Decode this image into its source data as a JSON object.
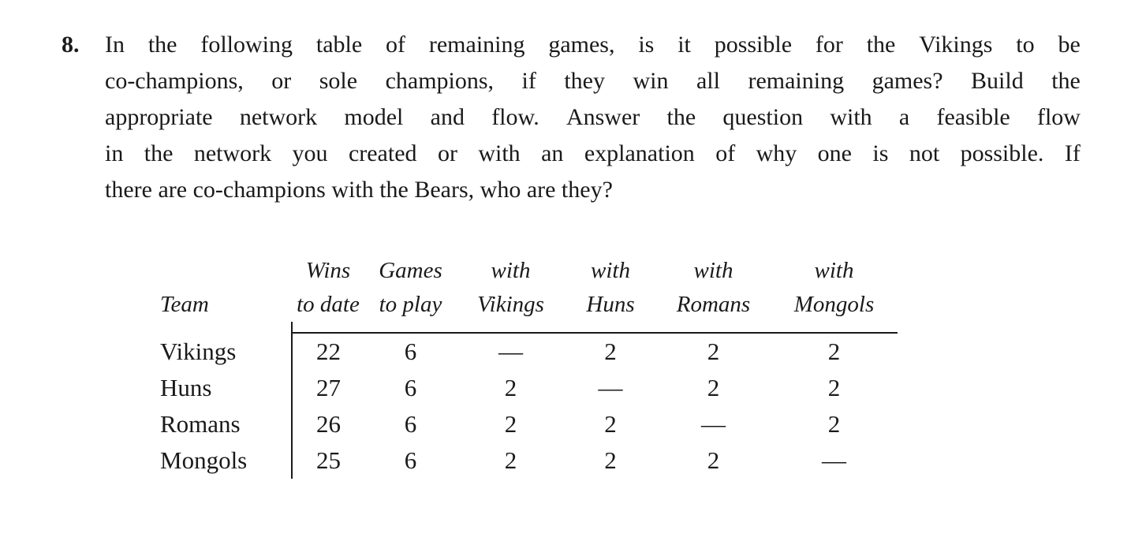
{
  "problem": {
    "number": "8.",
    "lines": [
      "In the following table of remaining games, is it possible for the Vikings to be",
      "co-champions, or sole champions, if they win all remaining games? Build the",
      "appropriate network model and flow. Answer the question with a feasible flow",
      "in the network you created or with an explanation of why one is not possible. If",
      "there are co-champions with the Bears, who are they?"
    ],
    "full_text": "In the following table of remaining games, is it possible for the Vikings to be co-champions, or sole champions, if they win all remaining games? Build the appropriate network model and flow. Answer the question with a feasible flow in the network you created or with an explanation of why one is not possible. If there are co-champions with the Bears, who are they?"
  },
  "table": {
    "headers": [
      {
        "line1": "",
        "line2": "Team"
      },
      {
        "line1": "Wins",
        "line2": "to date"
      },
      {
        "line1": "Games",
        "line2": "to play"
      },
      {
        "line1": "with",
        "line2": "Vikings"
      },
      {
        "line1": "with",
        "line2": "Huns"
      },
      {
        "line1": "with",
        "line2": "Romans"
      },
      {
        "line1": "with",
        "line2": "Mongols"
      }
    ],
    "rows": [
      {
        "team": "Vikings",
        "wins_to_date": "22",
        "games_to_play": "6",
        "with_vikings": "—",
        "with_huns": "2",
        "with_romans": "2",
        "with_mongols": "2"
      },
      {
        "team": "Huns",
        "wins_to_date": "27",
        "games_to_play": "6",
        "with_vikings": "2",
        "with_huns": "—",
        "with_romans": "2",
        "with_mongols": "2"
      },
      {
        "team": "Romans",
        "wins_to_date": "26",
        "games_to_play": "6",
        "with_vikings": "2",
        "with_huns": "2",
        "with_romans": "—",
        "with_mongols": "2"
      },
      {
        "team": "Mongols",
        "wins_to_date": "25",
        "games_to_play": "6",
        "with_vikings": "2",
        "with_huns": "2",
        "with_romans": "2",
        "with_mongols": "—"
      }
    ]
  },
  "colors": {
    "ink": "#1a1a1a",
    "background": "#ffffff"
  }
}
